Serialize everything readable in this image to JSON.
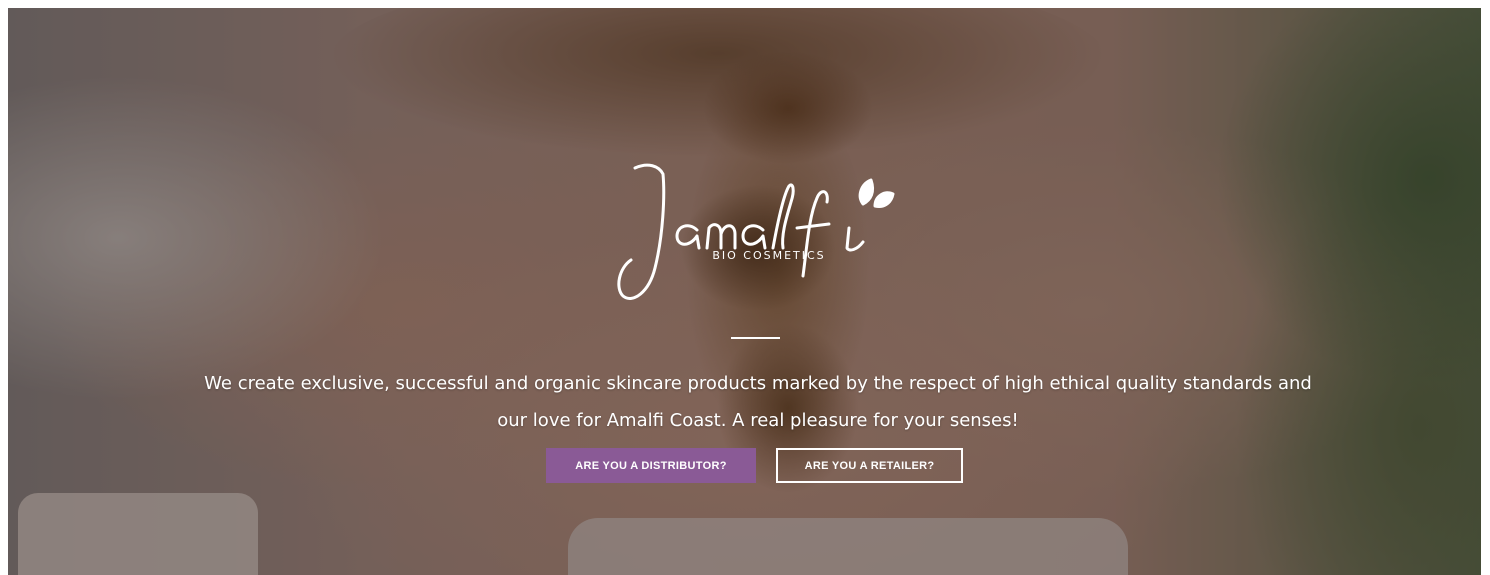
{
  "brand": {
    "logo_text": "Jamalfi",
    "tagline": "BIO COSMETICS"
  },
  "hero": {
    "intro_line1": "We create exclusive, successful and organic skincare products marked by the respect of high ethical quality standards and",
    "intro_line2": "our love for Amalfi Coast. A real pleasure for your senses!"
  },
  "buttons": {
    "distributor_label": "ARE YOU A DISTRIBUTOR?",
    "retailer_label": "ARE YOU A RETAILER?"
  },
  "colors": {
    "accent": "#8a5a96",
    "text": "#ffffff"
  }
}
